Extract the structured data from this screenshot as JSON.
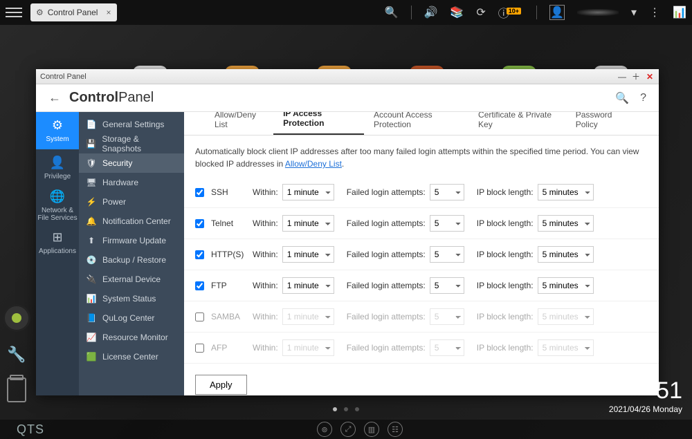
{
  "topbar": {
    "tab_label": "Control Panel",
    "notification_badge": "10+"
  },
  "window": {
    "title_bar": "Control Panel",
    "header_bold": "Control",
    "header_light": "Panel"
  },
  "categories": [
    {
      "label": "System",
      "active": true
    },
    {
      "label": "Privilege",
      "active": false
    },
    {
      "label": "Network & File Services",
      "active": false
    },
    {
      "label": "Applications",
      "active": false
    }
  ],
  "sub_items": [
    {
      "label": "General Settings",
      "active": false
    },
    {
      "label": "Storage & Snapshots",
      "active": false
    },
    {
      "label": "Security",
      "active": true
    },
    {
      "label": "Hardware",
      "active": false
    },
    {
      "label": "Power",
      "active": false
    },
    {
      "label": "Notification Center",
      "active": false
    },
    {
      "label": "Firmware Update",
      "active": false
    },
    {
      "label": "Backup / Restore",
      "active": false
    },
    {
      "label": "External Device",
      "active": false
    },
    {
      "label": "System Status",
      "active": false
    },
    {
      "label": "QuLog Center",
      "active": false
    },
    {
      "label": "Resource Monitor",
      "active": false
    },
    {
      "label": "License Center",
      "active": false
    }
  ],
  "tabs": [
    {
      "label": "Allow/Deny List",
      "active": false
    },
    {
      "label": "IP Access Protection",
      "active": true
    },
    {
      "label": "Account Access Protection",
      "active": false
    },
    {
      "label": "Certificate & Private Key",
      "active": false
    },
    {
      "label": "Password Policy",
      "active": false
    }
  ],
  "description": {
    "text": "Automatically block client IP addresses after too many failed login attempts within the specified time period. You can view blocked IP addresses in ",
    "link": "Allow/Deny List",
    "after": "."
  },
  "labels": {
    "within": "Within:",
    "failed": "Failed login attempts:",
    "block": "IP block length:",
    "apply": "Apply"
  },
  "protocols": [
    {
      "name": "SSH",
      "enabled": true,
      "within": "1 minute",
      "attempts": "5",
      "block": "5 minutes"
    },
    {
      "name": "Telnet",
      "enabled": true,
      "within": "1 minute",
      "attempts": "5",
      "block": "5 minutes"
    },
    {
      "name": "HTTP(S)",
      "enabled": true,
      "within": "1 minute",
      "attempts": "5",
      "block": "5 minutes"
    },
    {
      "name": "FTP",
      "enabled": true,
      "within": "1 minute",
      "attempts": "5",
      "block": "5 minutes"
    },
    {
      "name": "SAMBA",
      "enabled": false,
      "within": "1 minute",
      "attempts": "5",
      "block": "5 minutes"
    },
    {
      "name": "AFP",
      "enabled": false,
      "within": "1 minute",
      "attempts": "5",
      "block": "5 minutes"
    }
  ],
  "clock": {
    "time_fragment": "51",
    "date": "2021/04/26 Monday"
  },
  "footer_logo": "QTS"
}
